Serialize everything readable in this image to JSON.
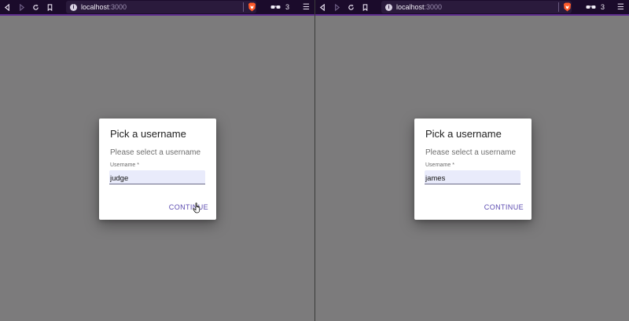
{
  "colors": {
    "toolbar_bg": "#1b0b2b",
    "toolbar_accent": "#5c2a8c",
    "page_bg": "#7c7b7c",
    "dialog_bg": "#ffffff",
    "input_bg": "#e9ebfb",
    "button_text": "#5b4ab0"
  },
  "windows": [
    {
      "toolbar": {
        "url_host": "localhost",
        "url_port": ":3000",
        "extension_count": "3",
        "icons": [
          "back-icon",
          "forward-icon",
          "reload-icon",
          "bookmark-icon",
          "info-icon",
          "brave-shield-icon",
          "glasses-icon",
          "menu-icon"
        ]
      },
      "dialog": {
        "title": "Pick a username",
        "text": "Please select a username",
        "field_label": "Username *",
        "field_value": "judge",
        "button_label": "CONTINUE"
      }
    },
    {
      "toolbar": {
        "url_host": "localhost",
        "url_port": ":3000",
        "extension_count": "3",
        "icons": [
          "back-icon",
          "forward-icon",
          "reload-icon",
          "bookmark-icon",
          "info-icon",
          "brave-shield-icon",
          "glasses-icon",
          "menu-icon"
        ]
      },
      "dialog": {
        "title": "Pick a username",
        "text": "Please select a username",
        "field_label": "Username *",
        "field_value": "james",
        "button_label": "CONTINUE"
      }
    }
  ]
}
